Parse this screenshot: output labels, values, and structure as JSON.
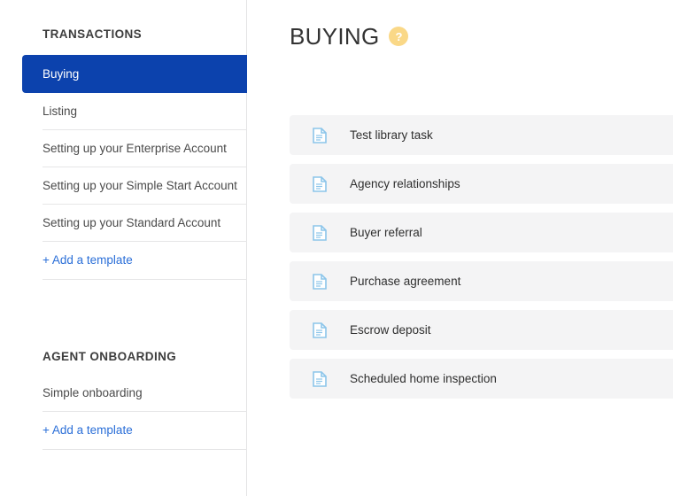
{
  "sidebar": {
    "groups": [
      {
        "title": "TRANSACTIONS",
        "items": [
          {
            "label": "Buying",
            "active": true
          },
          {
            "label": "Listing",
            "active": false
          },
          {
            "label": "Setting up your Enterprise Account",
            "active": false
          },
          {
            "label": "Setting up your Simple Start Account",
            "active": false
          },
          {
            "label": "Setting up your Standard Account",
            "active": false
          }
        ],
        "add_label": "+ Add a template"
      },
      {
        "title": "AGENT ONBOARDING",
        "items": [
          {
            "label": "Simple onboarding",
            "active": false
          }
        ],
        "add_label": "+ Add a template"
      }
    ]
  },
  "main": {
    "title": "BUYING",
    "help_icon": "question-mark-circle-icon",
    "help_label": "?",
    "tasks": [
      {
        "icon": "document-icon",
        "label": "Test library task"
      },
      {
        "icon": "document-icon",
        "label": "Agency relationships"
      },
      {
        "icon": "document-icon",
        "label": "Buyer referral"
      },
      {
        "icon": "document-icon",
        "label": "Purchase agreement"
      },
      {
        "icon": "document-icon",
        "label": "Escrow deposit"
      },
      {
        "icon": "document-icon",
        "label": "Scheduled home inspection"
      }
    ]
  },
  "colors": {
    "active_nav": "#0c42ad",
    "link": "#2b6fd8",
    "row_bg": "#f4f4f5",
    "help_badge": "#fad887",
    "doc_icon": "#8cc5ea"
  }
}
